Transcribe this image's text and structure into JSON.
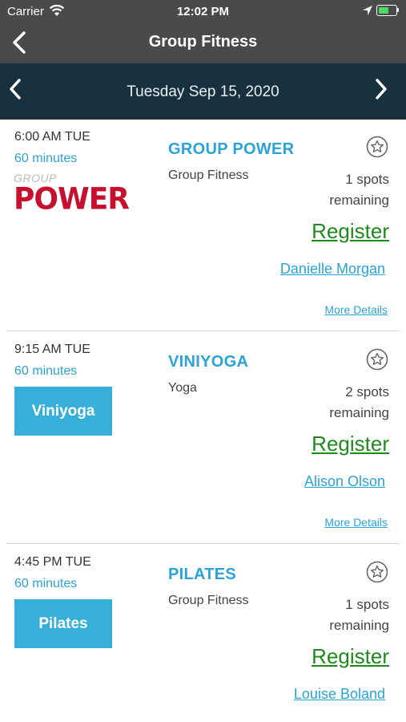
{
  "status": {
    "carrier": "Carrier",
    "time": "12:02 PM"
  },
  "nav": {
    "title": "Group Fitness"
  },
  "date": {
    "label": "Tuesday Sep 15, 2020"
  },
  "classes": [
    {
      "time": "6:00 AM TUE",
      "duration": "60 minutes",
      "logo_small": "GROUP",
      "logo_big": "POWER",
      "name": "GROUP POWER",
      "category": "Group Fitness",
      "spots_line1": "1 spots",
      "spots_line2": "remaining",
      "register": "Register",
      "instructor": "Danielle Morgan",
      "details": "More Details"
    },
    {
      "time": "9:15 AM TUE",
      "duration": "60 minutes",
      "tile": "Viniyoga",
      "name": "VINIYOGA",
      "category": "Yoga",
      "spots_line1": "2 spots",
      "spots_line2": "remaining",
      "register": "Register",
      "instructor": "Alison Olson",
      "details": "More Details"
    },
    {
      "time": "4:45 PM TUE",
      "duration": "60 minutes",
      "tile": "Pilates",
      "name": "PILATES",
      "category": "Group Fitness",
      "spots_line1": "1 spots",
      "spots_line2": "remaining",
      "register": "Register",
      "instructor": "Louise Boland"
    }
  ],
  "colors": {
    "nav_bg": "#4a4a4a",
    "date_bg": "#17313f",
    "accent": "#2aa3d6",
    "register": "#1e8a1e",
    "brand_red": "#c8102e"
  },
  "icons": [
    "wifi-icon",
    "location-icon",
    "battery-icon",
    "back-chevron-icon",
    "chevron-left-icon",
    "chevron-right-icon",
    "star-icon"
  ]
}
